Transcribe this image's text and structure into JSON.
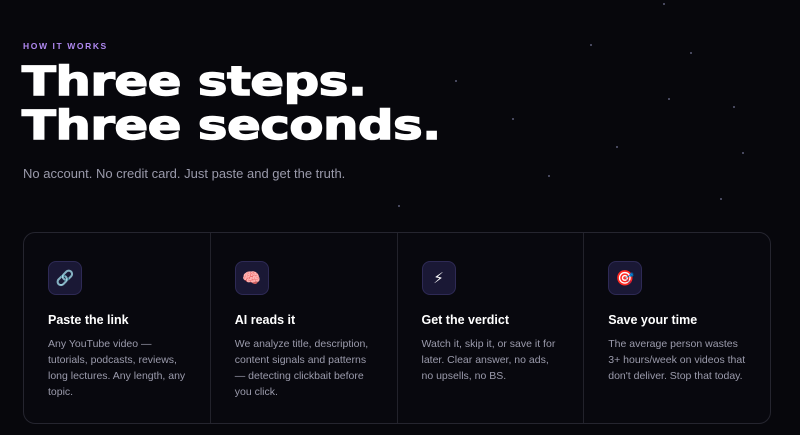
{
  "section": {
    "eyebrow": "HOW IT WORKS",
    "headline_line1": "Three steps.",
    "headline_line2": "Three seconds.",
    "subtitle": "No account. No credit card. Just paste and get the truth."
  },
  "steps": [
    {
      "icon": "link-icon",
      "icon_glyph": "🔗",
      "title": "Paste the link",
      "description": "Any YouTube video — tutorials, podcasts, reviews, long lectures. Any length, any topic."
    },
    {
      "icon": "brain-icon",
      "icon_glyph": "🧠",
      "title": "AI reads it",
      "description": "We analyze title, description, content signals and patterns — detecting clickbait before you click."
    },
    {
      "icon": "lightning-icon",
      "icon_glyph": "⚡",
      "title": "Get the verdict",
      "description": "Watch it, skip it, or save it for later. Clear answer, no ads, no upsells, no BS."
    },
    {
      "icon": "target-icon",
      "icon_glyph": "🎯",
      "title": "Save your time",
      "description": "The average person wastes 3+ hours/week on videos that don't deliver. Stop that today."
    }
  ],
  "colors": {
    "background": "#07070c",
    "accent": "#b089f2",
    "card_border": "#25252f",
    "icon_bg": "#1a1835"
  }
}
